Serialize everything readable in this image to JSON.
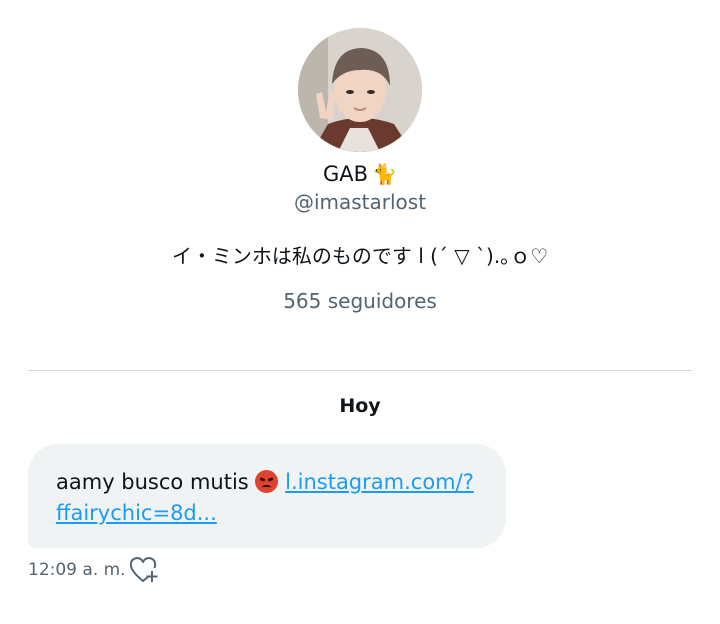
{
  "profile": {
    "display_name": "GAB",
    "name_emoji": "🐈",
    "handle": "@imastarlost",
    "bio": "イ・ミンホは私のものです l (´ ▽ `).｡ｏ♡",
    "followers": "565 seguidores"
  },
  "conversation": {
    "date_label": "Hoy",
    "message": {
      "text": "aamy busco mutis",
      "emoji_icon": "angry-face-icon",
      "link_line1": "l.instagram.com/?",
      "link_line2": "ffairychic=8d...",
      "time": "12:09 a. m.",
      "reaction_icon": "heart-plus-icon"
    }
  },
  "colors": {
    "text_primary": "#0f1419",
    "text_secondary": "#536471",
    "link": "#1d9bf0",
    "bubble_bg": "#eff3f4",
    "divider": "#cfd9de"
  }
}
